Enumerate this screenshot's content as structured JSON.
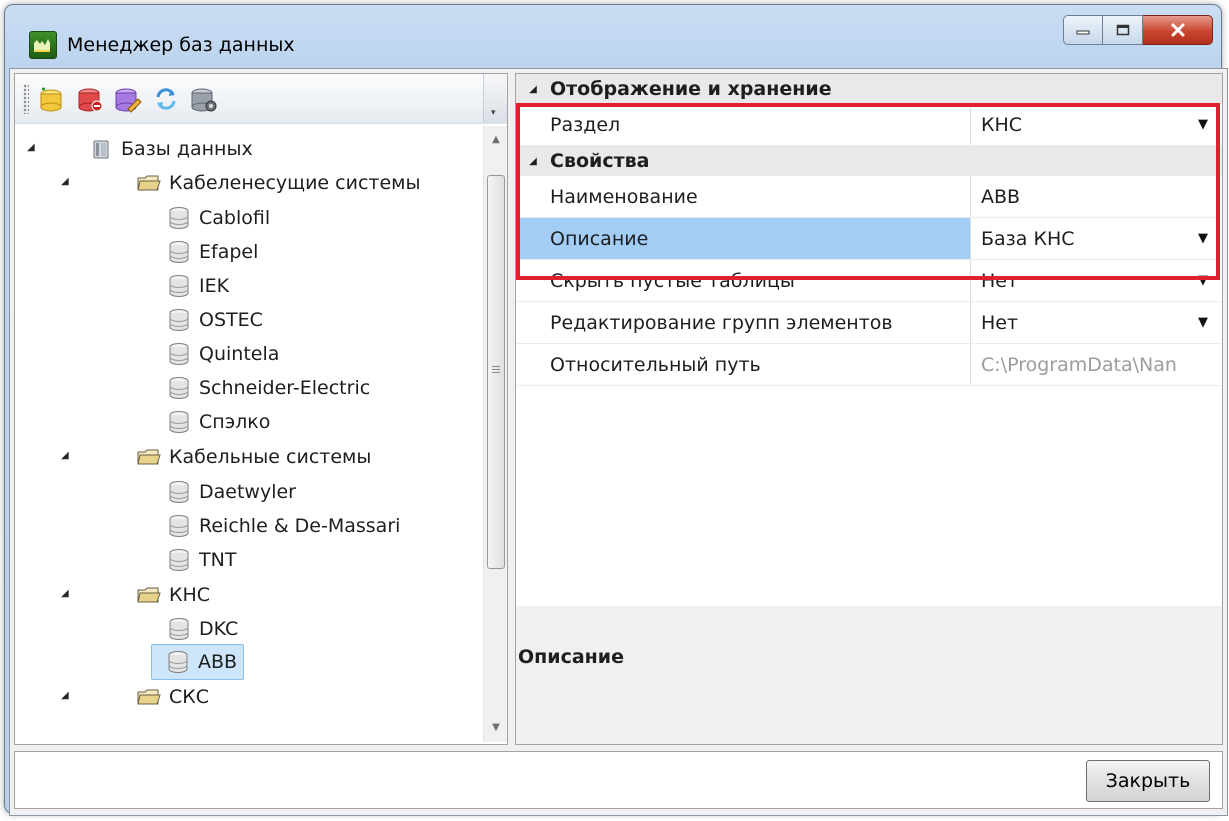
{
  "window": {
    "title": "Менеджер баз данных"
  },
  "toolbar": {
    "buttons": [
      "add-database-icon",
      "remove-database-icon",
      "edit-database-icon",
      "refresh-icon",
      "database-settings-icon"
    ]
  },
  "tree": {
    "root": "Базы данных",
    "groups": [
      {
        "label": "Кабеленесущие системы",
        "items": [
          "Cablofil",
          "Efapel",
          "IEK",
          "OSTEC",
          "Quintela",
          "Schneider-Electric",
          "Спэлко"
        ]
      },
      {
        "label": "Кабельные системы",
        "items": [
          "Daetwyler",
          "Reichle & De-Massari",
          "TNT"
        ]
      },
      {
        "label": "КНС",
        "items": [
          "DKC",
          "ABB"
        ]
      },
      {
        "label": "СКС",
        "items": []
      }
    ],
    "selected": "ABB"
  },
  "properties": {
    "category_storage": "Отображение и хранение",
    "category_props": "Свойства",
    "rows": {
      "section": {
        "name": "Раздел",
        "value": "КНС"
      },
      "naming": {
        "name": "Наименование",
        "value": "ABB"
      },
      "description": {
        "name": "Описание",
        "value": "База КНС"
      },
      "hide_empty": {
        "name": "Скрыть пустые таблицы",
        "value": "Нет"
      },
      "edit_groups": {
        "name": "Редактирование групп элементов",
        "value": "Нет"
      },
      "relative_path": {
        "name": "Относительный путь",
        "value": "C:\\ProgramData\\Nan"
      }
    },
    "help_title": "Описание"
  },
  "footer": {
    "close_label": "Закрыть"
  },
  "colors": {
    "highlight": "#e0202f",
    "selection": "#cde6fb",
    "row_selection": "#a3cdf5"
  }
}
